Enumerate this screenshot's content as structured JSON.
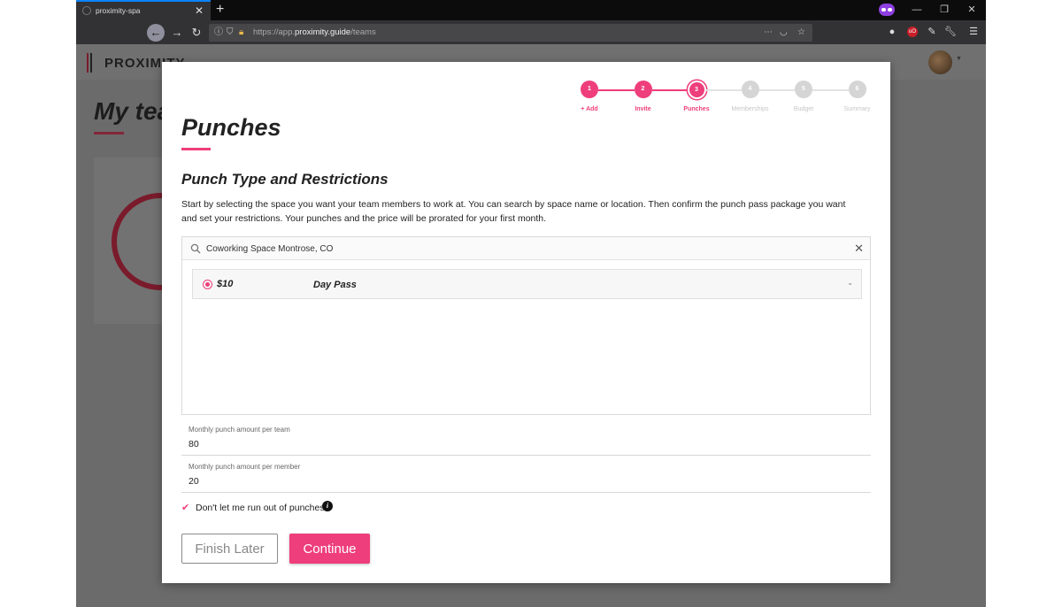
{
  "browser": {
    "tab_title": "proximity-spa",
    "tab_close": "✕",
    "new_tab": "+",
    "url_prefix": "https://app.",
    "url_host": "proximity.guide",
    "url_path": "/teams",
    "icons": [
      "back-icon",
      "forward-icon",
      "reload-icon",
      "info-icon",
      "shield-icon",
      "lock-icon",
      "more-icon",
      "pocket-icon",
      "bookmark-star-icon",
      "ublock-icon",
      "pen-icon",
      "wrench-icon",
      "menu-icon"
    ]
  },
  "app": {
    "logo_text": "PROXIMITY",
    "page_title": "My teams"
  },
  "modal": {
    "stepper": [
      {
        "number": "1",
        "label": "+ Add",
        "state": "done"
      },
      {
        "number": "2",
        "label": "Invite",
        "state": "done"
      },
      {
        "number": "3",
        "label": "Punches",
        "state": "active"
      },
      {
        "number": "4",
        "label": "Memberships",
        "state": "pending"
      },
      {
        "number": "5",
        "label": "Budget",
        "state": "pending"
      },
      {
        "number": "6",
        "label": "Summary",
        "state": "pending"
      }
    ],
    "title": "Punches",
    "section_title": "Punch Type and Restrictions",
    "instructions": "Start by selecting the space you want your team members to work at. You can search by space name or location. Then confirm the punch pass package you want and set your restrictions. Your punches and the price will be prorated for your first month.",
    "search": {
      "value": "Coworking Space Montrose, CO",
      "clear": "✕"
    },
    "pass": {
      "price": "$10",
      "name": "Day Pass",
      "selected": true
    },
    "fields": [
      {
        "label": "Monthly punch amount per team",
        "value": "80"
      },
      {
        "label": "Monthly punch amount per member",
        "value": "20"
      }
    ],
    "checkbox": {
      "label": "Don't let me run out of punches.",
      "checked": true,
      "info": "i"
    },
    "buttons": {
      "finish_later": "Finish Later",
      "continue": "Continue"
    }
  },
  "colors": {
    "accent": "#ee3e7b",
    "pending": "#d5d5d5",
    "text": "#222222"
  }
}
